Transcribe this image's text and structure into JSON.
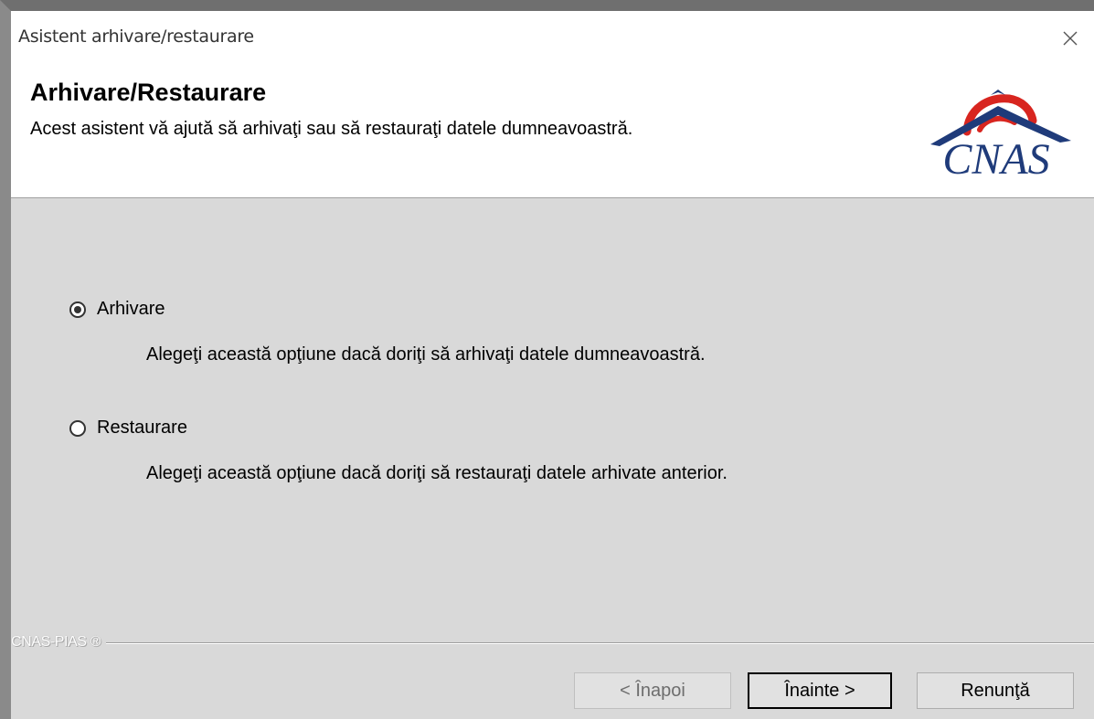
{
  "window": {
    "title": "Asistent arhivare/restaurare"
  },
  "header": {
    "title": "Arhivare/Restaurare",
    "subtitle": "Acest asistent vă ajută să arhivaţi sau să restauraţi datele dumneavoastră.",
    "logo_text": "CNAS",
    "logo_colors": {
      "text": "#1f3b7a",
      "arc": "#d8251f",
      "roof": "#1f3b7a"
    }
  },
  "options": [
    {
      "label": "Arhivare",
      "description": "Alegeţi această opţiune dacă doriţi să arhivaţi datele dumneavoastră.",
      "selected": true
    },
    {
      "label": "Restaurare",
      "description": "Alegeţi această opţiune dacă doriţi să restauraţi datele arhivate anterior.",
      "selected": false
    }
  ],
  "footer": {
    "brand": "CNAS-PIAS ®"
  },
  "buttons": {
    "back": "< Înapoi",
    "next": "Înainte >",
    "cancel": "Renunţă"
  },
  "icons": {
    "close": "close-icon"
  }
}
